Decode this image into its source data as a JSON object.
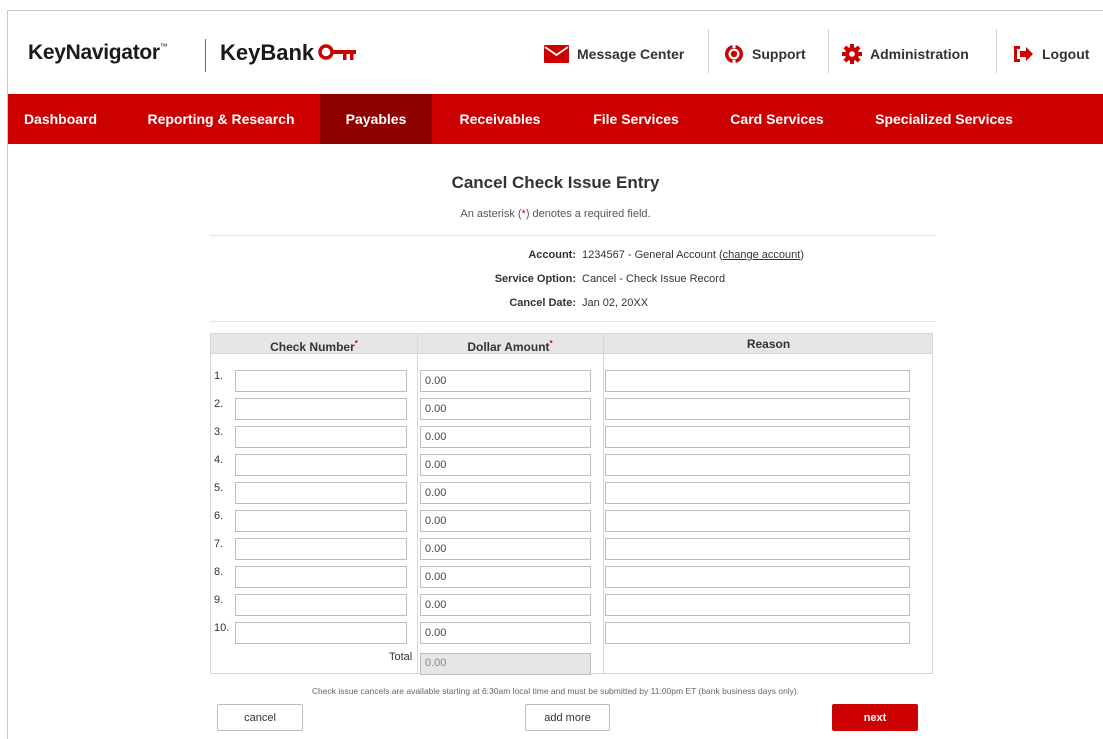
{
  "brand": {
    "product": "KeyNavigator",
    "product_mark": "™",
    "bank": "KeyBank"
  },
  "utility_nav": [
    {
      "label": "Message Center",
      "icon": "envelope-icon"
    },
    {
      "label": "Support",
      "icon": "lifebuoy-icon"
    },
    {
      "label": "Administration",
      "icon": "gear-icon"
    },
    {
      "label": "Logout",
      "icon": "logout-icon"
    }
  ],
  "main_nav": [
    {
      "label": "Dashboard",
      "active": false
    },
    {
      "label": "Reporting & Research",
      "active": false
    },
    {
      "label": "Payables",
      "active": true
    },
    {
      "label": "Receivables",
      "active": false
    },
    {
      "label": "File Services",
      "active": false
    },
    {
      "label": "Card Services",
      "active": false
    },
    {
      "label": "Specialized Services",
      "active": false
    }
  ],
  "page": {
    "title": "Cancel Check Issue Entry",
    "required_note_prefix": "An asterisk (",
    "required_note_star": "*",
    "required_note_suffix": ") denotes a required field."
  },
  "info": {
    "account_label": "Account:",
    "account_value": "1234567 - General Account (",
    "change_account_link": "change account",
    "account_value_close": ")",
    "service_option_label": "Service Option:",
    "service_option_value": "Cancel - Check Issue Record",
    "cancel_date_label": "Cancel Date:",
    "cancel_date_value": "Jan 02, 20XX"
  },
  "grid": {
    "columns": [
      "Check Number",
      "Dollar Amount",
      "Reason"
    ],
    "required_star": "*",
    "rows": [
      {
        "num": "1.",
        "check_number": "",
        "amount": "0.00",
        "reason": ""
      },
      {
        "num": "2.",
        "check_number": "",
        "amount": "0.00",
        "reason": ""
      },
      {
        "num": "3.",
        "check_number": "",
        "amount": "0.00",
        "reason": ""
      },
      {
        "num": "4.",
        "check_number": "",
        "amount": "0.00",
        "reason": ""
      },
      {
        "num": "5.",
        "check_number": "",
        "amount": "0.00",
        "reason": ""
      },
      {
        "num": "6.",
        "check_number": "",
        "amount": "0.00",
        "reason": ""
      },
      {
        "num": "7.",
        "check_number": "",
        "amount": "0.00",
        "reason": ""
      },
      {
        "num": "8.",
        "check_number": "",
        "amount": "0.00",
        "reason": ""
      },
      {
        "num": "9.",
        "check_number": "",
        "amount": "0.00",
        "reason": ""
      },
      {
        "num": "10.",
        "check_number": "",
        "amount": "0.00",
        "reason": ""
      }
    ],
    "total_label": "Total",
    "total_value": "0.00"
  },
  "footnote": "Check issue cancels are available starting at 6:30am local time and must be submitted by 11:00pm ET (bank business days only).",
  "buttons": {
    "cancel": "cancel",
    "add_more": "add more",
    "next": "next"
  },
  "colors": {
    "brand_red": "#cc0000",
    "active_nav": "#8f0000"
  }
}
